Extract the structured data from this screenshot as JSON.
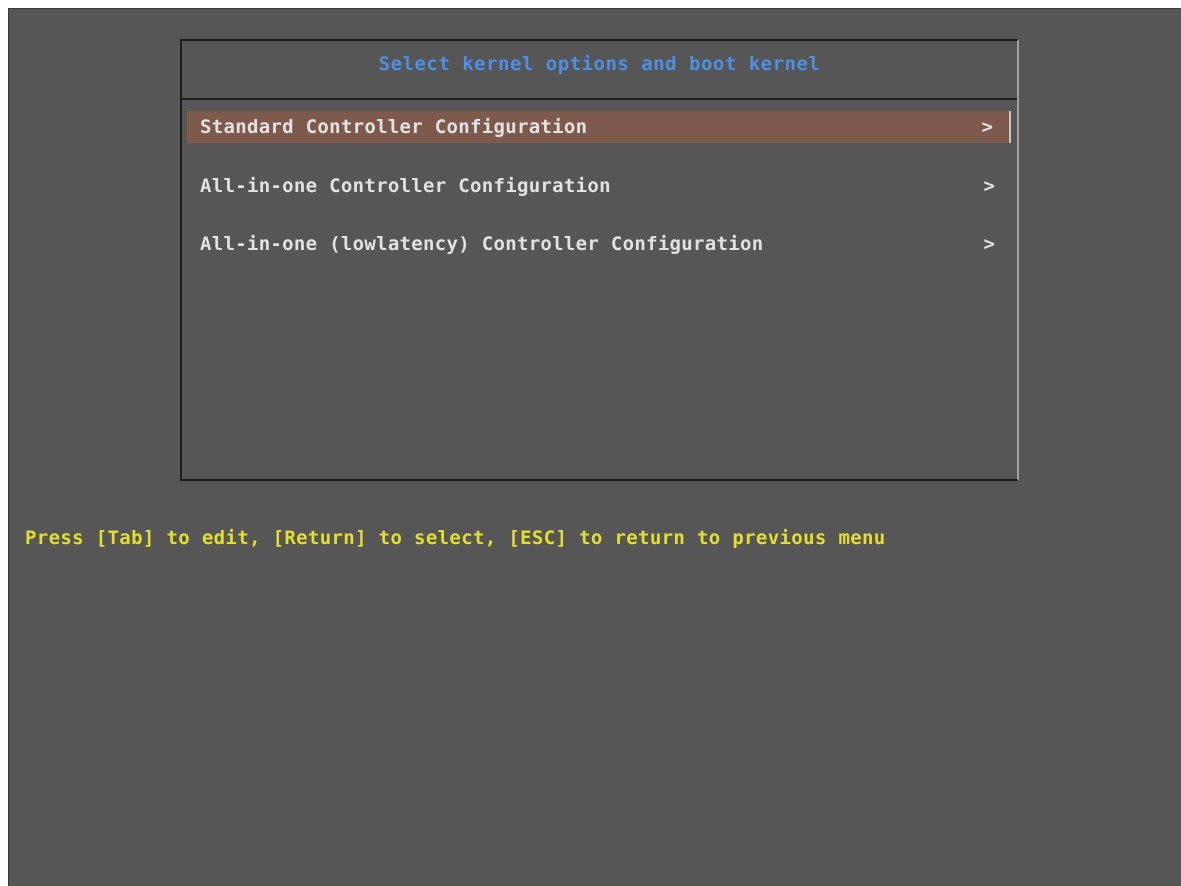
{
  "boot_menu": {
    "title": "Select kernel options and boot kernel",
    "items": [
      {
        "label": "Standard Controller Configuration",
        "arrow": ">",
        "selected": true
      },
      {
        "label": "All-in-one Controller Configuration",
        "arrow": ">",
        "selected": false
      },
      {
        "label": "All-in-one (lowlatency) Controller Configuration",
        "arrow": ">",
        "selected": false
      }
    ]
  },
  "footer": {
    "hint": "Press [Tab] to edit, [Return] to select, [ESC] to return to previous menu"
  },
  "colors": {
    "background": "#565656",
    "title": "#4d8fe0",
    "item_text": "#e2e2e2",
    "selected_bg": "#7e5a4c",
    "hint_text": "#e3df2c"
  }
}
